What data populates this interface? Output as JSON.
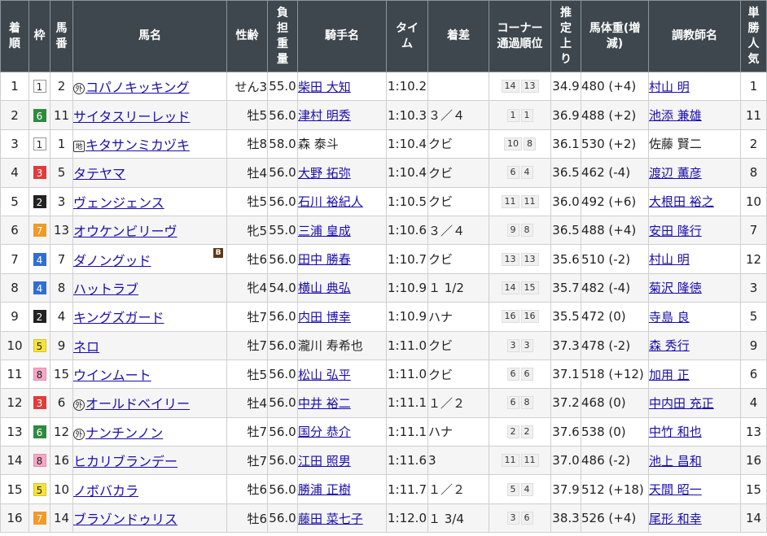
{
  "headers": {
    "rank": "着順",
    "waku": "枠",
    "umaban": "馬番",
    "horse": "馬名",
    "sex_age": "性齢",
    "weight_carried": "負担重量",
    "jockey": "騎手名",
    "time": "タイム",
    "margin": "着差",
    "corner": "コーナー通過順位",
    "last3f": "推定上り",
    "body_weight": "馬体重(増減)",
    "trainer": "調教師名",
    "popularity": "単勝人気"
  },
  "rows": [
    {
      "rank": "1",
      "waku": "1",
      "umaban": "2",
      "mark": "外",
      "horse": "コパノキッキング",
      "blinker": "",
      "sex_age": "せん3",
      "weight": "55.0",
      "jockey": "柴田 大知",
      "jockey_link": true,
      "time": "1:10.2",
      "margin": "",
      "corner": [
        "14",
        "13"
      ],
      "last3f": "34.9",
      "body_weight": "480 (+4)",
      "trainer": "村山 明",
      "trainer_link": true,
      "popularity": "1"
    },
    {
      "rank": "2",
      "waku": "6",
      "umaban": "11",
      "mark": "",
      "horse": "サイタスリーレッド",
      "blinker": "",
      "sex_age": "牡5",
      "weight": "56.0",
      "jockey": "津村 明秀",
      "jockey_link": true,
      "time": "1:10.3",
      "margin": "３／４",
      "corner": [
        "1",
        "1"
      ],
      "last3f": "36.9",
      "body_weight": "488 (+2)",
      "trainer": "池添 兼雄",
      "trainer_link": true,
      "popularity": "11"
    },
    {
      "rank": "3",
      "waku": "1",
      "umaban": "1",
      "mark": "地",
      "horse": "キタサンミカヅキ",
      "blinker": "",
      "sex_age": "牡8",
      "weight": "58.0",
      "jockey": "森 泰斗",
      "jockey_link": false,
      "time": "1:10.4",
      "margin": "クビ",
      "corner": [
        "10",
        "8"
      ],
      "last3f": "36.1",
      "body_weight": "530 (+2)",
      "trainer": "佐藤 賢二",
      "trainer_link": false,
      "popularity": "2"
    },
    {
      "rank": "4",
      "waku": "3",
      "umaban": "5",
      "mark": "",
      "horse": "タテヤマ",
      "blinker": "",
      "sex_age": "牡4",
      "weight": "56.0",
      "jockey": "大野 拓弥",
      "jockey_link": true,
      "time": "1:10.4",
      "margin": "クビ",
      "corner": [
        "6",
        "4"
      ],
      "last3f": "36.5",
      "body_weight": "462 (-4)",
      "trainer": "渡辺 薫彦",
      "trainer_link": true,
      "popularity": "8"
    },
    {
      "rank": "5",
      "waku": "2",
      "umaban": "3",
      "mark": "",
      "horse": "ヴェンジェンス",
      "blinker": "",
      "sex_age": "牡5",
      "weight": "56.0",
      "jockey": "石川 裕紀人",
      "jockey_link": true,
      "time": "1:10.5",
      "margin": "クビ",
      "corner": [
        "11",
        "11"
      ],
      "last3f": "36.0",
      "body_weight": "492 (+6)",
      "trainer": "大根田 裕之",
      "trainer_link": true,
      "popularity": "10"
    },
    {
      "rank": "6",
      "waku": "7",
      "umaban": "13",
      "mark": "",
      "horse": "オウケンビリーヴ",
      "blinker": "",
      "sex_age": "牝5",
      "weight": "55.0",
      "jockey": "三浦 皇成",
      "jockey_link": true,
      "time": "1:10.6",
      "margin": "３／４",
      "corner": [
        "9",
        "8"
      ],
      "last3f": "36.5",
      "body_weight": "488 (+4)",
      "trainer": "安田 隆行",
      "trainer_link": true,
      "popularity": "7"
    },
    {
      "rank": "7",
      "waku": "4",
      "umaban": "7",
      "mark": "",
      "horse": "ダノングッド",
      "blinker": "B",
      "sex_age": "牡6",
      "weight": "56.0",
      "jockey": "田中 勝春",
      "jockey_link": true,
      "time": "1:10.7",
      "margin": "クビ",
      "corner": [
        "13",
        "13"
      ],
      "last3f": "35.6",
      "body_weight": "510 (-2)",
      "trainer": "村山 明",
      "trainer_link": true,
      "popularity": "12"
    },
    {
      "rank": "8",
      "waku": "4",
      "umaban": "8",
      "mark": "",
      "horse": "ハットラブ",
      "blinker": "",
      "sex_age": "牝4",
      "weight": "54.0",
      "jockey": "横山 典弘",
      "jockey_link": true,
      "time": "1:10.9",
      "margin": "１ 1/2",
      "corner": [
        "14",
        "15"
      ],
      "last3f": "35.7",
      "body_weight": "482 (-4)",
      "trainer": "菊沢 隆徳",
      "trainer_link": true,
      "popularity": "3"
    },
    {
      "rank": "9",
      "waku": "2",
      "umaban": "4",
      "mark": "",
      "horse": "キングズガード",
      "blinker": "",
      "sex_age": "牡7",
      "weight": "56.0",
      "jockey": "内田 博幸",
      "jockey_link": true,
      "time": "1:10.9",
      "margin": "ハナ",
      "corner": [
        "16",
        "16"
      ],
      "last3f": "35.5",
      "body_weight": "472 (0)",
      "trainer": "寺島 良",
      "trainer_link": true,
      "popularity": "5"
    },
    {
      "rank": "10",
      "waku": "5",
      "umaban": "9",
      "mark": "",
      "horse": "ネロ",
      "blinker": "",
      "sex_age": "牡7",
      "weight": "56.0",
      "jockey": "瀧川 寿希也",
      "jockey_link": false,
      "time": "1:11.0",
      "margin": "クビ",
      "corner": [
        "3",
        "3"
      ],
      "last3f": "37.3",
      "body_weight": "478 (-2)",
      "trainer": "森 秀行",
      "trainer_link": true,
      "popularity": "9"
    },
    {
      "rank": "11",
      "waku": "8",
      "umaban": "15",
      "mark": "",
      "horse": "ウインムート",
      "blinker": "",
      "sex_age": "牡5",
      "weight": "56.0",
      "jockey": "松山 弘平",
      "jockey_link": true,
      "time": "1:11.0",
      "margin": "クビ",
      "corner": [
        "6",
        "6"
      ],
      "last3f": "37.1",
      "body_weight": "518 (+12)",
      "trainer": "加用 正",
      "trainer_link": true,
      "popularity": "6"
    },
    {
      "rank": "12",
      "waku": "3",
      "umaban": "6",
      "mark": "外",
      "horse": "オールドベイリー",
      "blinker": "",
      "sex_age": "牡4",
      "weight": "56.0",
      "jockey": "中井 裕二",
      "jockey_link": true,
      "time": "1:11.1",
      "margin": "１／２",
      "corner": [
        "6",
        "8"
      ],
      "last3f": "37.2",
      "body_weight": "468 (0)",
      "trainer": "中内田 充正",
      "trainer_link": true,
      "popularity": "4"
    },
    {
      "rank": "13",
      "waku": "6",
      "umaban": "12",
      "mark": "外",
      "horse": "ナンチンノン",
      "blinker": "",
      "sex_age": "牡7",
      "weight": "56.0",
      "jockey": "国分 恭介",
      "jockey_link": true,
      "time": "1:11.1",
      "margin": "ハナ",
      "corner": [
        "2",
        "2"
      ],
      "last3f": "37.6",
      "body_weight": "538 (0)",
      "trainer": "中竹 和也",
      "trainer_link": true,
      "popularity": "13"
    },
    {
      "rank": "14",
      "waku": "8",
      "umaban": "16",
      "mark": "",
      "horse": "ヒカリブランデー",
      "blinker": "",
      "sex_age": "牡7",
      "weight": "56.0",
      "jockey": "江田 照男",
      "jockey_link": true,
      "time": "1:11.6",
      "margin": "3",
      "corner": [
        "11",
        "11"
      ],
      "last3f": "37.0",
      "body_weight": "486 (-2)",
      "trainer": "池上 昌和",
      "trainer_link": true,
      "popularity": "16"
    },
    {
      "rank": "15",
      "waku": "5",
      "umaban": "10",
      "mark": "",
      "horse": "ノボバカラ",
      "blinker": "",
      "sex_age": "牡6",
      "weight": "56.0",
      "jockey": "勝浦 正樹",
      "jockey_link": true,
      "time": "1:11.7",
      "margin": "１／２",
      "corner": [
        "5",
        "4"
      ],
      "last3f": "37.9",
      "body_weight": "512 (+18)",
      "trainer": "天間 昭一",
      "trainer_link": true,
      "popularity": "15"
    },
    {
      "rank": "16",
      "waku": "7",
      "umaban": "14",
      "mark": "",
      "horse": "ブラゾンドゥリス",
      "blinker": "",
      "sex_age": "牡6",
      "weight": "56.0",
      "jockey": "藤田 菜七子",
      "jockey_link": true,
      "time": "1:12.0",
      "margin": "１ 3/4",
      "corner": [
        "3",
        "6"
      ],
      "last3f": "38.3",
      "body_weight": "526 (+4)",
      "trainer": "尾形 和幸",
      "trainer_link": true,
      "popularity": "14"
    }
  ]
}
